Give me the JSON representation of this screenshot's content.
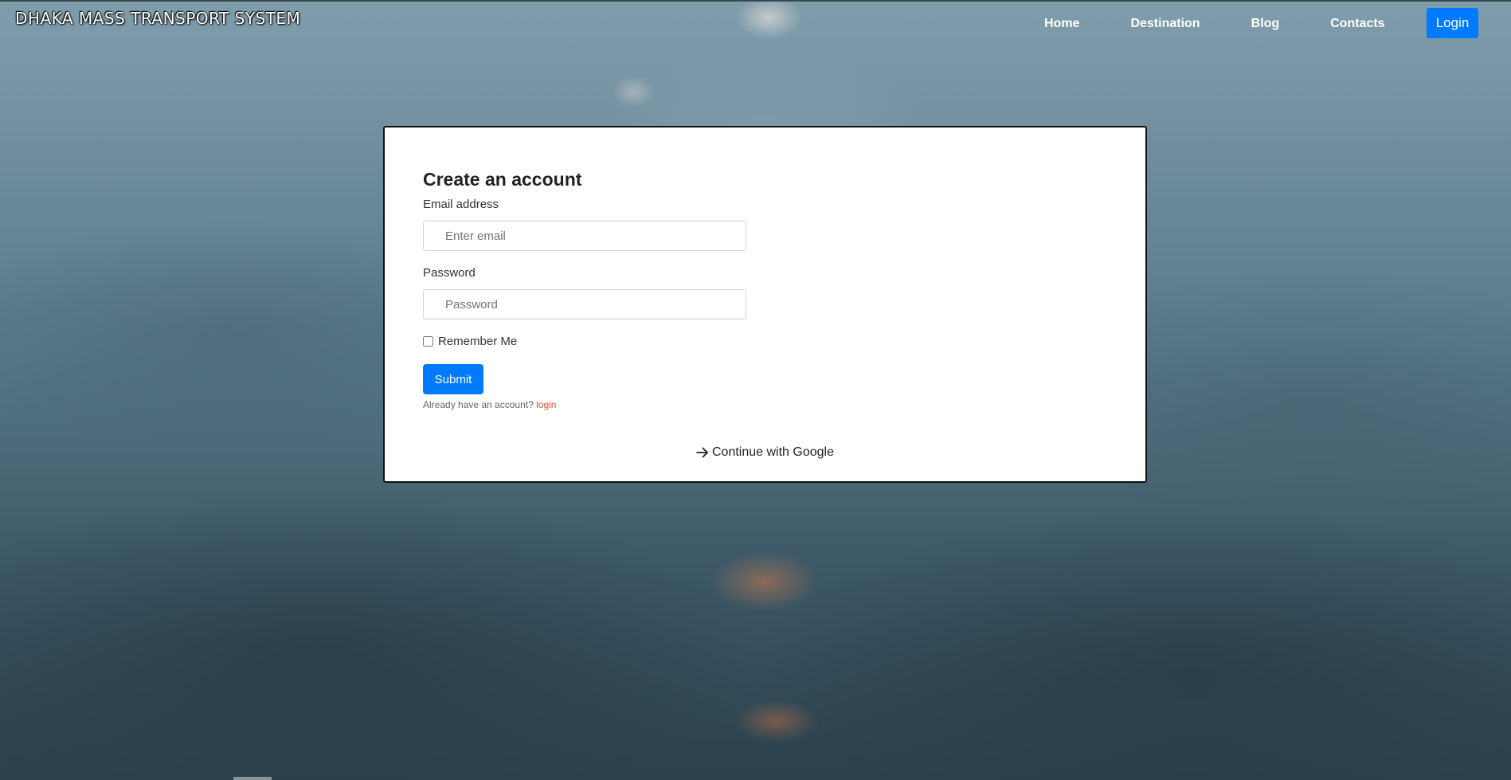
{
  "brand": "DHAKA MASS TRANSPORT SYSTEM",
  "nav": {
    "items": [
      "Home",
      "Destination",
      "Blog",
      "Contacts"
    ],
    "login_label": "Login"
  },
  "form": {
    "title": "Create an account",
    "email_label": "Email address",
    "email_placeholder": "Enter email",
    "password_label": "Password",
    "password_placeholder": "Password",
    "remember_label": "Remember Me",
    "submit_label": "Submit",
    "already_text": "Already have an account?",
    "login_link": "login",
    "google_label": "Continue with Google",
    "google_icon": "arrow-right-icon"
  },
  "colors": {
    "primary": "#007bff",
    "link": "#e74c3c"
  }
}
